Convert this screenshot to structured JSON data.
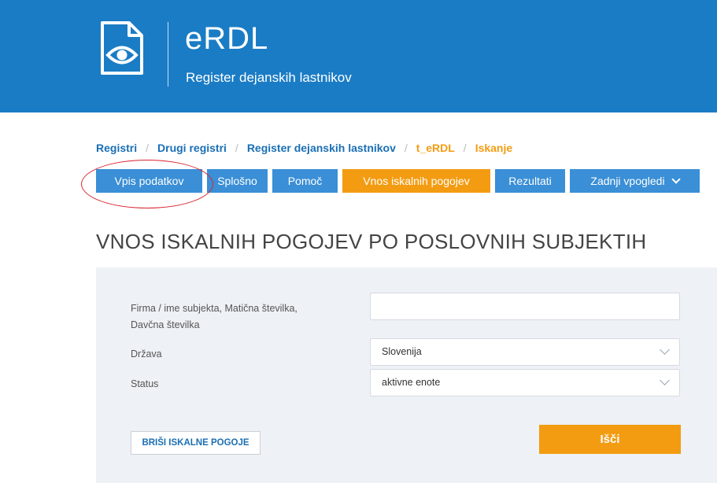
{
  "header": {
    "title": "eRDL",
    "subtitle": "Register dejanskih lastnikov",
    "logo_icon": "document-eye-icon"
  },
  "breadcrumb": {
    "items": [
      "Registri",
      "Drugi registri",
      "Register dejanskih lastnikov",
      "t_eRDL",
      "Iskanje"
    ],
    "separator": "/"
  },
  "tabs": [
    {
      "label": "Vpis podatkov"
    },
    {
      "label": "Splošno"
    },
    {
      "label": "Pomoč"
    },
    {
      "label": "Vnos iskalnih pogojev"
    },
    {
      "label": "Rezultati"
    },
    {
      "label": "Zadnji vpogledi"
    }
  ],
  "active_tab": "Vnos iskalnih pogojev",
  "section": {
    "title": "VNOS ISKALNIH POGOJEV PO POSLOVNIH SUBJEKTIH"
  },
  "form": {
    "subject_label_line1": "Firma / ime subjekta, Matična številka,",
    "subject_label_line2": "Davčna številka",
    "subject_value": "",
    "country_label": "Država",
    "country_value": "Slovenija",
    "status_label": "Status",
    "status_value": "aktivne enote"
  },
  "buttons": {
    "clear": "BRIŠI ISKALNE POGOJE",
    "search": "Išči"
  },
  "colors": {
    "header": "#1a7cc5",
    "tab": "#3a8fd6",
    "active": "#f39c12",
    "annotation": "#d9232e"
  }
}
